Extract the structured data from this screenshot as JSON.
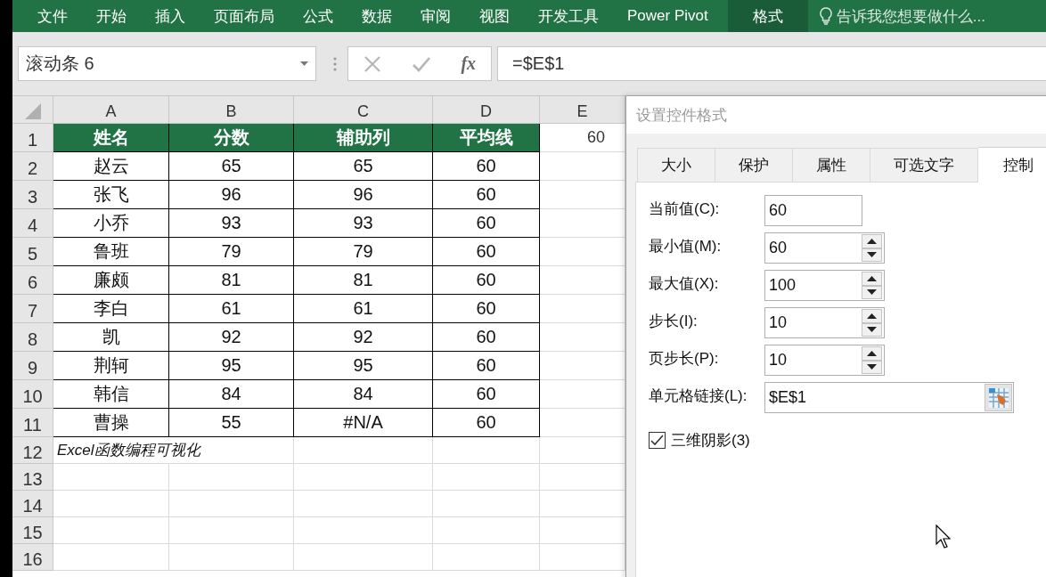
{
  "ribbon": {
    "tabs": [
      {
        "label": "文件",
        "selected": false
      },
      {
        "label": "开始",
        "selected": false
      },
      {
        "label": "插入",
        "selected": false
      },
      {
        "label": "页面布局",
        "selected": false
      },
      {
        "label": "公式",
        "selected": false
      },
      {
        "label": "数据",
        "selected": false
      },
      {
        "label": "审阅",
        "selected": false
      },
      {
        "label": "视图",
        "selected": false
      },
      {
        "label": "开发工具",
        "selected": false
      },
      {
        "label": "Power Pivot",
        "selected": false
      },
      {
        "label": "格式",
        "selected": true
      }
    ],
    "tell_me": "告诉我您想要做什么..."
  },
  "formula_bar": {
    "name_box": "滚动条 6",
    "function_button": "fx",
    "formula": "=$E$1"
  },
  "sheet": {
    "columns": [
      "A",
      "B",
      "C",
      "D",
      "E"
    ],
    "rows": [
      {
        "number": "1",
        "kind": "header",
        "cells": [
          "姓名",
          "分数",
          "辅助列",
          "平均线"
        ],
        "column_e": "60"
      },
      {
        "number": "2",
        "kind": "data",
        "cells": [
          "赵云",
          "65",
          "65",
          "60"
        ]
      },
      {
        "number": "3",
        "kind": "data",
        "cells": [
          "张飞",
          "96",
          "96",
          "60"
        ]
      },
      {
        "number": "4",
        "kind": "data",
        "cells": [
          "小乔",
          "93",
          "93",
          "60"
        ]
      },
      {
        "number": "5",
        "kind": "data",
        "cells": [
          "鲁班",
          "79",
          "79",
          "60"
        ]
      },
      {
        "number": "6",
        "kind": "data",
        "cells": [
          "廉颇",
          "81",
          "81",
          "60"
        ]
      },
      {
        "number": "7",
        "kind": "data",
        "cells": [
          "李白",
          "61",
          "61",
          "60"
        ]
      },
      {
        "number": "8",
        "kind": "data",
        "cells": [
          "凯",
          "92",
          "92",
          "60"
        ]
      },
      {
        "number": "9",
        "kind": "data",
        "cells": [
          "荆轲",
          "95",
          "95",
          "60"
        ]
      },
      {
        "number": "10",
        "kind": "data",
        "cells": [
          "韩信",
          "84",
          "84",
          "60"
        ]
      },
      {
        "number": "11",
        "kind": "data",
        "cells": [
          "曹操",
          "55",
          "#N/A",
          "60"
        ]
      },
      {
        "number": "12",
        "kind": "note",
        "text": "Excel函数编程可视化"
      },
      {
        "number": "13",
        "kind": "blank"
      },
      {
        "number": "14",
        "kind": "blank"
      },
      {
        "number": "15",
        "kind": "blank"
      },
      {
        "number": "16",
        "kind": "blank"
      }
    ]
  },
  "dialog": {
    "title": "设置控件格式",
    "tabs": [
      {
        "label": "大小",
        "selected": false
      },
      {
        "label": "保护",
        "selected": false
      },
      {
        "label": "属性",
        "selected": false
      },
      {
        "label": "可选文字",
        "selected": false
      },
      {
        "label": "控制",
        "selected": true
      }
    ],
    "fields": [
      {
        "label": "当前值(C):",
        "kind": "text",
        "value": "60"
      },
      {
        "label": "最小值(M):",
        "kind": "spinner",
        "value": "60"
      },
      {
        "label": "最大值(X):",
        "kind": "spinner",
        "value": "100"
      },
      {
        "label": "步长(I):",
        "kind": "spinner",
        "value": "10"
      },
      {
        "label": "页步长(P):",
        "kind": "spinner",
        "value": "10"
      },
      {
        "label": "单元格链接(L):",
        "kind": "reference",
        "value": "$E$1"
      }
    ],
    "checkbox": {
      "label": "三维阴影(3)",
      "checked": true
    }
  }
}
